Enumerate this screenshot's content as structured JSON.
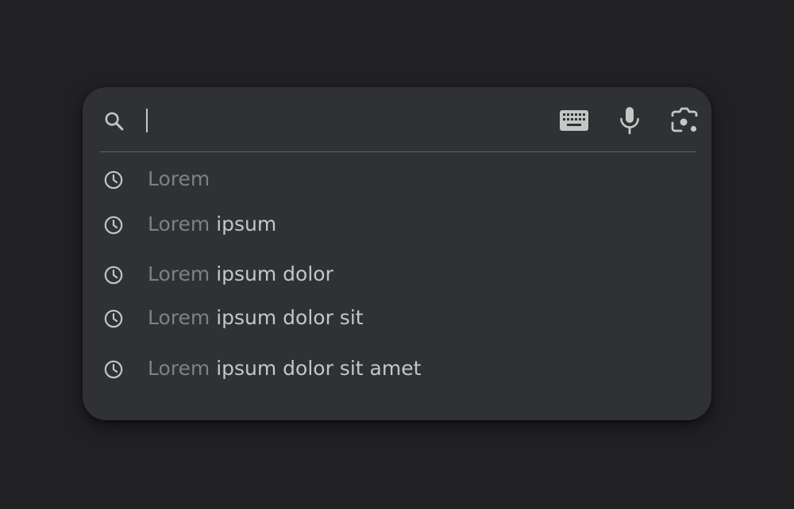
{
  "search": {
    "placeholder": "",
    "value": ""
  },
  "toolbar": {
    "icons": [
      "search-icon",
      "keyboard-icon",
      "microphone-icon",
      "camera-icon"
    ]
  },
  "suggestions": [
    {
      "query": "Lorem",
      "rest": ""
    },
    {
      "query": "Lorem",
      "rest": " ipsum"
    },
    {
      "query": "Lorem",
      "rest": " ipsum dolor"
    },
    {
      "query": "Lorem",
      "rest": " ipsum dolor sit"
    },
    {
      "query": "Lorem",
      "rest": " ipsum dolor sit amet"
    }
  ],
  "colors": {
    "background": "#212124",
    "card": "#303134",
    "icon": "#c4c7c5",
    "typed_text": "#7d8086",
    "suggested_text": "#c4c7c5",
    "divider": "#5f6368"
  }
}
